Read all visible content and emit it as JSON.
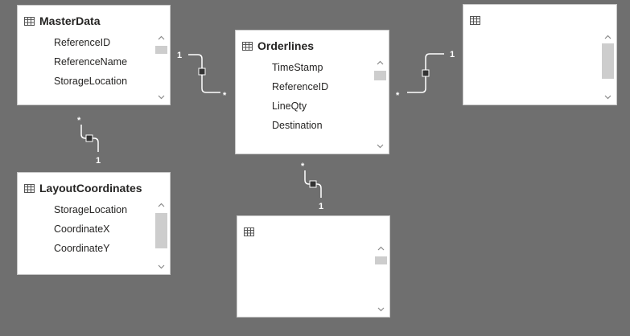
{
  "tables": {
    "masterdata": {
      "title": "MasterData",
      "fields": [
        "ReferenceID",
        "ReferenceName",
        "StorageLocation"
      ]
    },
    "orderlines": {
      "title": "Orderlines",
      "fields": [
        "TimeStamp",
        "ReferenceID",
        "LineQty",
        "Destination"
      ]
    },
    "layoutcoordinates": {
      "title": "LayoutCoordinates",
      "fields": [
        "StorageLocation",
        "CoordinateX",
        "CoordinateY"
      ]
    },
    "unnamed_right": {
      "title": ""
    },
    "unnamed_bottom": {
      "title": ""
    }
  },
  "relationships": {
    "masterdata_orderlines": {
      "from_card": "1",
      "to_card": "*"
    },
    "orderlines_right": {
      "from_card": "*",
      "to_card": "1"
    },
    "masterdata_layout": {
      "from_card": "*",
      "to_card": "1"
    },
    "orderlines_bottom": {
      "from_card": "*",
      "to_card": "1"
    }
  },
  "colors": {
    "canvas": "#6f6f6f",
    "card": "#ffffff",
    "connector": "#ffffff",
    "scroll_thumb": "#cdcdcd"
  }
}
